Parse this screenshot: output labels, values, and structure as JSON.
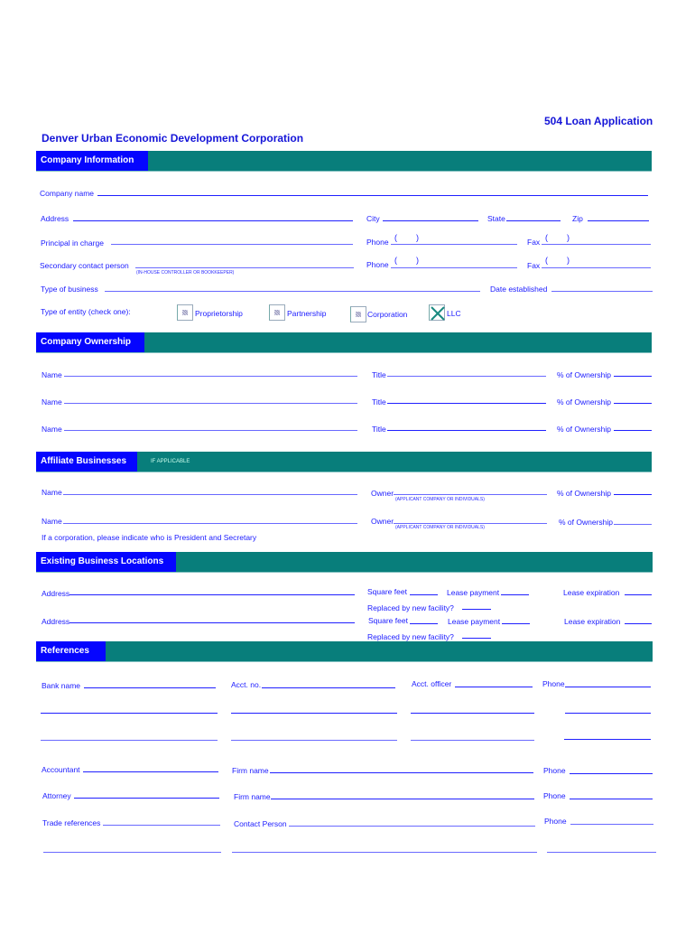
{
  "header": {
    "doc_title": "504 Loan Application",
    "org_name": "Denver Urban Economic Development Corporation"
  },
  "colors": {
    "tab_blue": "#0505ff",
    "bar_teal": "#087e7b",
    "text_blue": "#1a1aff"
  },
  "company_info": {
    "section": "Company Information",
    "company_name": "Company name",
    "address": "Address",
    "city": "City",
    "state": "State",
    "zip": "Zip",
    "principal": "Principal in charge",
    "phone": "Phone",
    "fax": "Fax",
    "paren_open": "(",
    "paren_close": ")",
    "secondary": "Secondary contact person",
    "secondary_note": "(IN-HOUSE CONTROLLER OR BOOKKEEPER)",
    "type_business": "Type of business",
    "date_established": "Date established",
    "entity_label": "Type of entity (check one):",
    "entities": [
      {
        "label": "Proprietorship",
        "checked": false
      },
      {
        "label": "Partnership",
        "checked": false
      },
      {
        "label": "Corporation",
        "checked": false
      },
      {
        "label": "LLC",
        "checked": true
      }
    ]
  },
  "ownership": {
    "section": "Company Ownership",
    "name": "Name",
    "title": "Title",
    "pct": "% of Ownership"
  },
  "affiliates": {
    "section": "Affiliate Businesses",
    "note": "IF APPLICABLE",
    "name": "Name",
    "owner": "Owner",
    "owner_note": "(APPLICANT COMPANY OR INDIVIDUALS)",
    "pct": "% of Ownership",
    "corp_note": "If a corporation, please indicate who is President and Secretary"
  },
  "locations": {
    "section": "Existing Business Locations",
    "address": "Address",
    "sqft": "Square feet",
    "lease_payment": "Lease payment",
    "lease_exp": "Lease expiration",
    "replaced": "Replaced by new facility?"
  },
  "references": {
    "section": "References",
    "bank": "Bank name",
    "acct": "Acct. no.",
    "officer": "Acct. officer",
    "phone": "Phone",
    "accountant": "Accountant",
    "firm": "Firm name",
    "attorney": "Attorney",
    "trade": "Trade references",
    "contact": "Contact Person"
  }
}
